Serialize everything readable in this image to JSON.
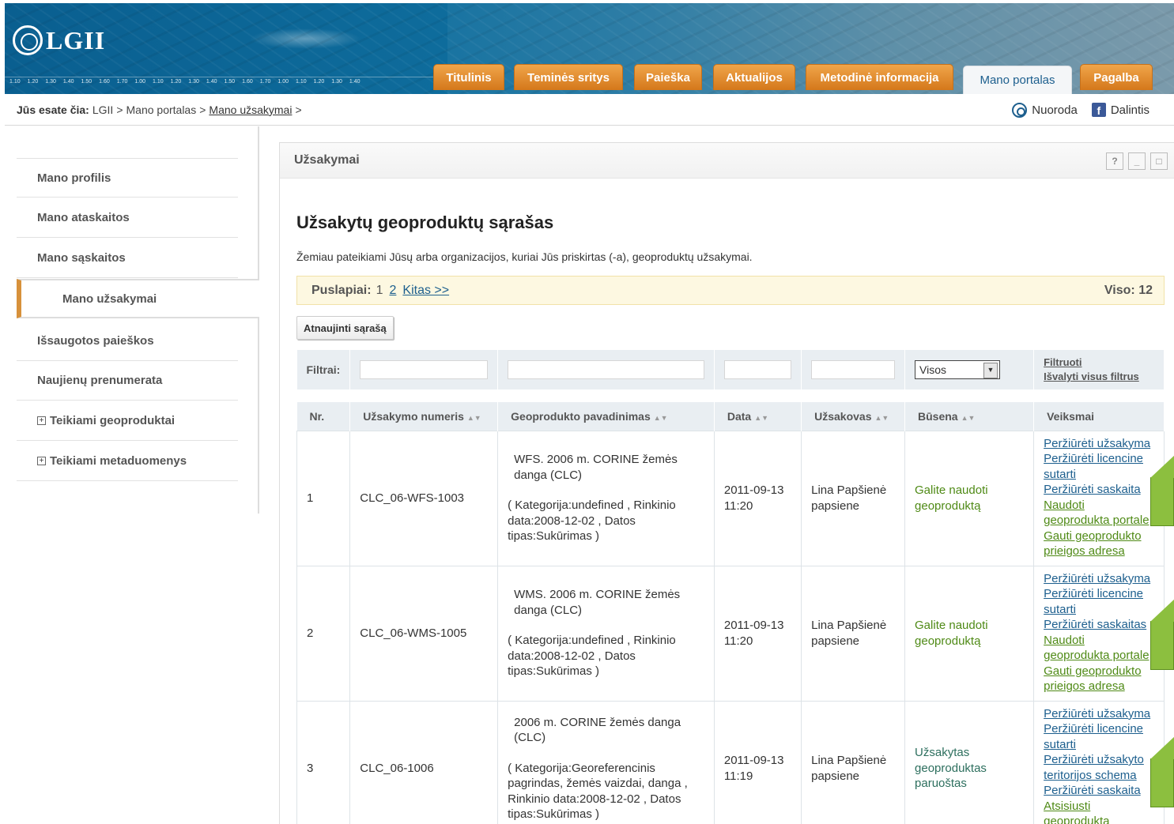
{
  "header": {
    "logo_text": "LGII",
    "ruler": [
      "1.10",
      "1.20",
      "1.30",
      "1.40",
      "1.50",
      "1.60",
      "1.70",
      "1.00",
      "1.10",
      "1.20",
      "1.30",
      "1.40",
      "1.50",
      "1.60",
      "1.70",
      "1.00",
      "1.10",
      "1.20",
      "1.30",
      "1.40"
    ],
    "tabs": [
      {
        "label": "Titulinis"
      },
      {
        "label": "Teminės sritys"
      },
      {
        "label": "Paieška"
      },
      {
        "label": "Aktualijos"
      },
      {
        "label": "Metodinė informacija"
      },
      {
        "label": "Mano portalas"
      },
      {
        "label": "Pagalba"
      }
    ]
  },
  "breadcrumb": {
    "prefix": "Jūs esate čia:",
    "items": [
      "LGII",
      "Mano portalas",
      "Mano užsakymai"
    ],
    "sep": ">",
    "share_link": "Nuoroda",
    "share_fb": "Dalintis"
  },
  "sidebar": {
    "items": [
      {
        "label": "Mano profilis"
      },
      {
        "label": "Mano ataskaitos"
      },
      {
        "label": "Mano sąskaitos"
      },
      {
        "label": "Mano užsakymai"
      },
      {
        "label": "Išsaugotos paieškos"
      },
      {
        "label": "Naujienų prenumerata"
      },
      {
        "label": "Teikiami geoproduktai",
        "expander": "+"
      },
      {
        "label": "Teikiami metaduomenys",
        "expander": "+"
      }
    ]
  },
  "portlet": {
    "title": "Užsakymai",
    "buttons": [
      "?",
      "_",
      "□"
    ],
    "heading": "Užsakytų geoproduktų sąrašas",
    "description": "Žemiau pateikiami Jūsų arba organizacijos, kuriai Jūs priskirtas (-a), geoproduktų užsakymai.",
    "pager": {
      "label": "Puslapiai:",
      "current": "1",
      "page2": "2",
      "next": "Kitas >>",
      "total": "Viso: 12"
    },
    "refresh_label": "Atnaujinti sąrašą",
    "filters": {
      "label": "Filtrai:",
      "status_value": "Visos",
      "apply": "Filtruoti",
      "clear": "Išvalyti visus filtrus"
    },
    "columns": [
      "Nr.",
      "Užsakymo numeris",
      "Geoprodukto pavadinimas",
      "Data",
      "Užsakovas",
      "Būsena",
      "Veiksmai"
    ],
    "rows": [
      {
        "nr": "1",
        "number": "CLC_06-WFS-1003",
        "name": "WFS. 2006 m. CORINE žemės danga (CLC)",
        "details": "( Kategorija:undefined , Rinkinio data:2008-12-02 , Datos tipas:Sukūrimas )",
        "date": "2011-09-13",
        "time": "11:20",
        "customer": "Lina Papšienė",
        "customer_login": "papsiene",
        "status": "Galite naudoti geoproduktą",
        "actions": [
          "Peržiūrėti užsakyma",
          "Peržiūrėti licencine",
          "sutarti",
          "Peržiūrėti saskaita",
          "Naudoti",
          "geoprodukta portale",
          "Gauti geoprodukto",
          "prieigos adresa"
        ]
      },
      {
        "nr": "2",
        "number": "CLC_06-WMS-1005",
        "name": "WMS. 2006 m. CORINE žemės danga (CLC)",
        "details": "( Kategorija:undefined , Rinkinio data:2008-12-02 , Datos tipas:Sukūrimas )",
        "date": "2011-09-13",
        "time": "11:20",
        "customer": "Lina Papšienė",
        "customer_login": "papsiene",
        "status": "Galite naudoti geoproduktą",
        "actions": [
          "Peržiūrėti užsakyma",
          "Peržiūrėti licencine",
          "sutarti",
          "Peržiūrėti saskaitas",
          "Naudoti",
          "geoprodukta portale",
          "Gauti geoprodukto",
          "prieigos adresa"
        ]
      },
      {
        "nr": "3",
        "number": "CLC_06-1006",
        "name": "2006 m. CORINE žemės danga (CLC)",
        "details": "( Kategorija:Georeferencinis pagrindas, žemės vaizdai, danga , Rinkinio data:2008-12-02 , Datos tipas:Sukūrimas )",
        "date": "2011-09-13",
        "time": "11:19",
        "customer": "Lina Papšienė",
        "customer_login": "papsiene",
        "status": "Užsakytas geoproduktas paruoštas",
        "actions": [
          "Peržiūrėti užsakyma",
          "Peržiūrėti licencine",
          "sutarti",
          "Peržiūrėti užsakyto",
          "teritorijos schema",
          "Peržiūrėti saskaita",
          "Atsisiusti",
          "geoprodukta"
        ]
      }
    ]
  },
  "colors": {
    "tab_orange": "#d4781b",
    "active_marker": "#d7913b",
    "link_blue": "#1d5f8e",
    "green_link": "#4f8a16",
    "callout_green": "#8cbf3f"
  }
}
